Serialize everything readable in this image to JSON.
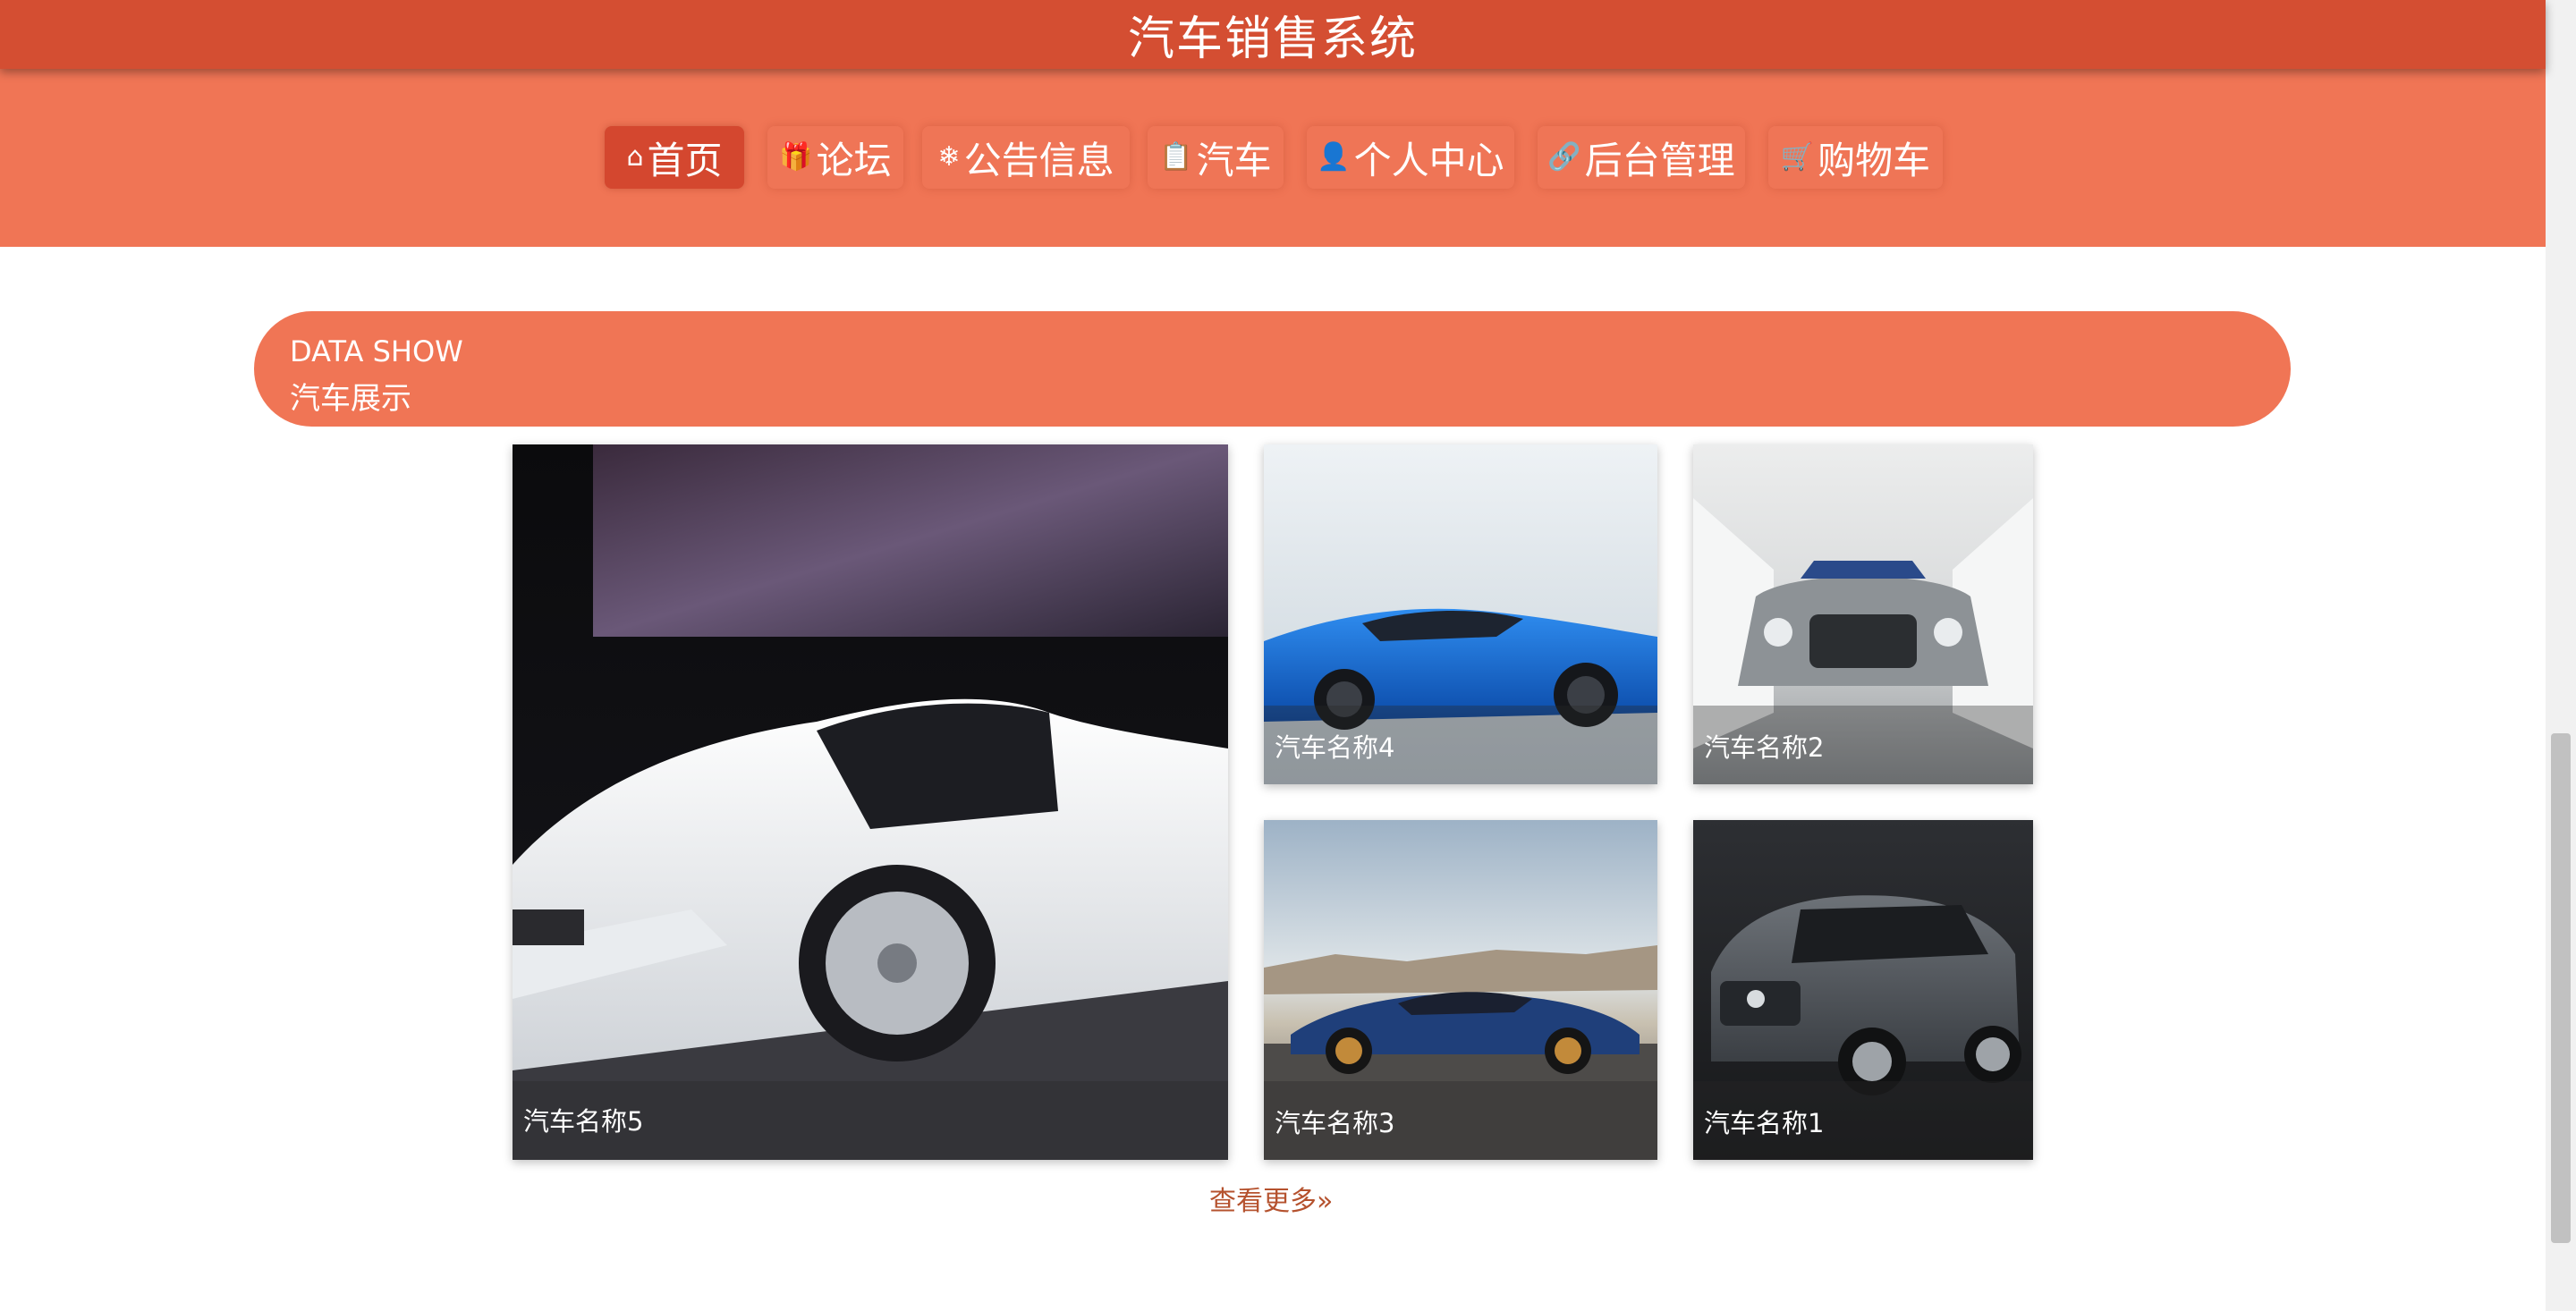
{
  "header": {
    "title": "汽车销售系统"
  },
  "nav": {
    "items": [
      {
        "label": "首页",
        "icon": "home-icon",
        "glyph": "⌂",
        "active": true
      },
      {
        "label": "论坛",
        "icon": "gift-icon",
        "glyph": "🎁",
        "active": false
      },
      {
        "label": "公告信息",
        "icon": "snowflake-icon",
        "glyph": "❄",
        "active": false
      },
      {
        "label": "汽车",
        "icon": "clipboard-icon",
        "glyph": "📋",
        "active": false
      },
      {
        "label": "个人中心",
        "icon": "user-icon",
        "glyph": "👤",
        "active": false
      },
      {
        "label": "后台管理",
        "icon": "link-icon",
        "glyph": "🔗",
        "active": false
      },
      {
        "label": "购物车",
        "icon": "cart-icon",
        "glyph": "🛒",
        "active": false
      }
    ]
  },
  "section": {
    "title_en": "DATA SHOW",
    "title_zh": "汽车展示"
  },
  "cars": [
    {
      "name": "汽车名称5"
    },
    {
      "name": "汽车名称4"
    },
    {
      "name": "汽车名称2"
    },
    {
      "name": "汽车名称3"
    },
    {
      "name": "汽车名称1"
    }
  ],
  "more": {
    "label": "查看更多»"
  },
  "colors": {
    "header": "#d44e32",
    "nav": "#f07555",
    "accent": "#b5522e"
  }
}
